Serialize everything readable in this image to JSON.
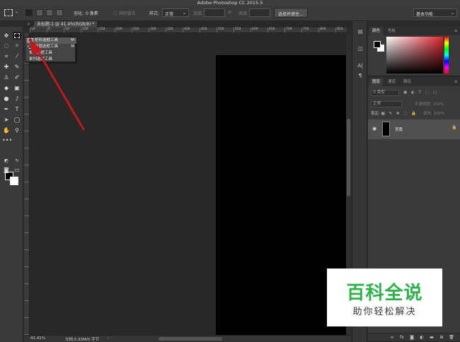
{
  "app": {
    "title": "Adobe Photoshop CC 2015.5"
  },
  "options_bar": {
    "feather_label": "羽化:",
    "feather_value": "0 像素",
    "antialias_label": "消除锯齿",
    "style_label": "样式:",
    "style_value": "正常",
    "width_label": "宽度:",
    "height_label": "高度:",
    "select_mask_button": "选择并遮住...",
    "workspace_value": "基本功能"
  },
  "document": {
    "tab_label": "未标题-1 @ 41.4%(RGB/8) *",
    "ruler_ticks": [
      "50",
      "0",
      "50",
      "100",
      "150",
      "200",
      "250",
      "300",
      "350",
      "400",
      "450",
      "500",
      "550",
      "600",
      "650",
      "700",
      "750",
      "800",
      "850"
    ]
  },
  "tool_flyout": {
    "items": [
      {
        "label": "矩形选框工具",
        "shortcut": "M"
      },
      {
        "label": "椭圆选框工具",
        "shortcut": "M"
      },
      {
        "label": "单行选框工具",
        "shortcut": ""
      },
      {
        "label": "单列选框工具",
        "shortcut": ""
      }
    ]
  },
  "status_bar": {
    "zoom": "41.41%",
    "doc_info": "文档:5.93M/0 字节"
  },
  "color_panel": {
    "tabs": [
      "颜色",
      "色板"
    ],
    "foreground": "#000000",
    "background": "#ffffff"
  },
  "layers_panel": {
    "tabs": [
      "图层",
      "通道",
      "路径"
    ],
    "kind_filter": "类型",
    "blend_mode": "正常",
    "opacity_label": "不透明度:",
    "opacity_value": "100%",
    "lock_label": "锁定:",
    "fill_label": "填充:",
    "fill_value": "100%",
    "layers": [
      {
        "name": "背景"
      }
    ],
    "footer_icons": [
      "link-icon",
      "fx-icon",
      "mask-icon",
      "adjustment-icon",
      "group-icon",
      "new-layer-icon",
      "trash-icon"
    ]
  },
  "watermark": {
    "title": "百科全说",
    "subtitle": "助你轻松解决"
  },
  "colors": {
    "accent_red": "#c0181f",
    "watermark_green": "#2db34a"
  }
}
